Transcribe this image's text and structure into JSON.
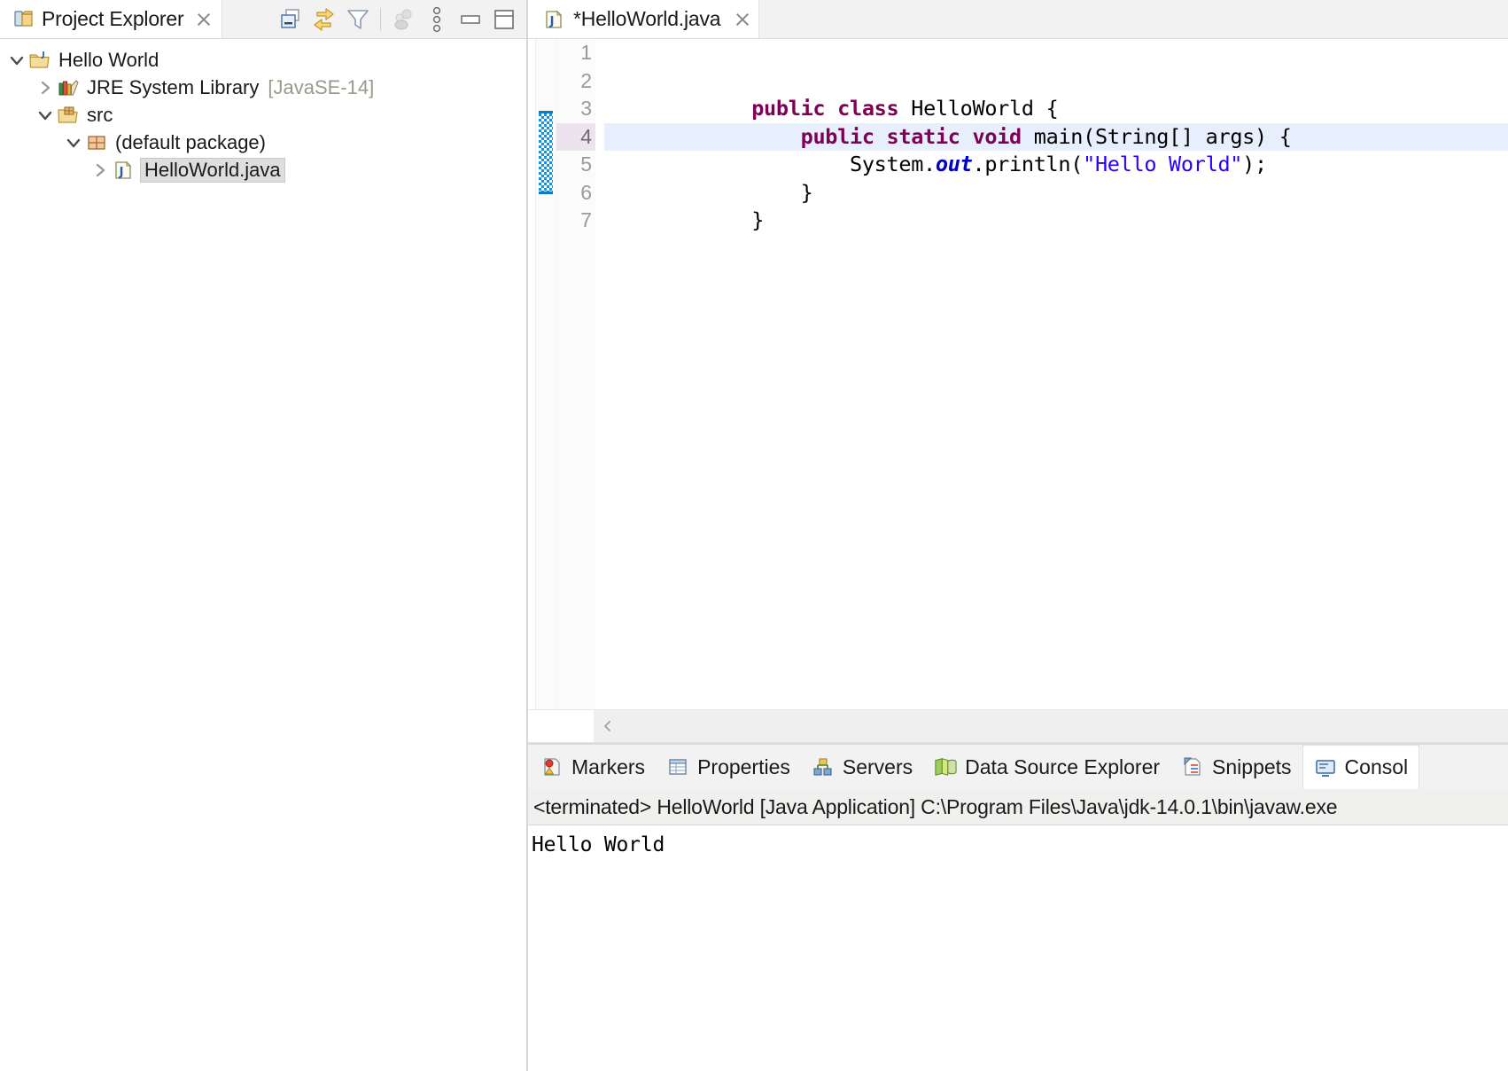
{
  "explorer": {
    "title": "Project Explorer",
    "icons": {
      "view": "project-explorer-icon",
      "close": "close-icon"
    },
    "toolbar": [
      {
        "name": "collapse-all-icon",
        "label": "Collapse All",
        "enabled": true
      },
      {
        "name": "link-with-editor-icon",
        "label": "Link with Editor",
        "enabled": true
      },
      {
        "name": "filter-icon",
        "label": "View Menu Filters",
        "enabled": true
      },
      {
        "name": "focus-on-active-task-icon",
        "label": "Focus on Active Task",
        "enabled": false
      },
      {
        "name": "view-menu-icon",
        "label": "View Menu",
        "enabled": true
      },
      {
        "name": "minimize-icon",
        "label": "Minimize",
        "enabled": true
      },
      {
        "name": "maximize-icon",
        "label": "Maximize",
        "enabled": true
      }
    ],
    "tree": [
      {
        "label": "Hello World",
        "sub": "",
        "depth": 0,
        "expanded": true,
        "icon": "java-project-icon",
        "selected": false
      },
      {
        "label": "JRE System Library",
        "sub": "[JavaSE-14]",
        "depth": 1,
        "expanded": false,
        "icon": "jre-library-icon",
        "selected": false
      },
      {
        "label": "src",
        "sub": "",
        "depth": 1,
        "expanded": true,
        "icon": "source-folder-icon",
        "selected": false
      },
      {
        "label": "(default package)",
        "sub": "",
        "depth": 2,
        "expanded": true,
        "icon": "package-icon",
        "selected": false
      },
      {
        "label": "HelloWorld.java",
        "sub": "",
        "depth": 3,
        "expanded": false,
        "icon": "java-file-icon",
        "selected": true
      }
    ]
  },
  "editor": {
    "tab": {
      "title": "*HelloWorld.java",
      "icon": "java-file-icon",
      "close_icon": "close-icon",
      "dirty": true
    },
    "lines": [
      {
        "number": "1",
        "current": false,
        "changed": false,
        "fold": false,
        "tokens": []
      },
      {
        "number": "2",
        "current": false,
        "changed": false,
        "fold": false,
        "tokens": [
          {
            "t": "public",
            "c": "kw"
          },
          {
            "t": " ",
            "c": "plain"
          },
          {
            "t": "class",
            "c": "kw"
          },
          {
            "t": " HelloWorld {",
            "c": "plain"
          }
        ]
      },
      {
        "number": "3",
        "current": false,
        "changed": true,
        "fold": true,
        "tokens": [
          {
            "t": "    ",
            "c": "plain"
          },
          {
            "t": "public",
            "c": "kw"
          },
          {
            "t": " ",
            "c": "plain"
          },
          {
            "t": "static",
            "c": "kw"
          },
          {
            "t": " ",
            "c": "plain"
          },
          {
            "t": "void",
            "c": "kw"
          },
          {
            "t": " main(String[] args) {",
            "c": "plain"
          }
        ]
      },
      {
        "number": "4",
        "current": true,
        "changed": true,
        "fold": false,
        "tokens": [
          {
            "t": "        System.",
            "c": "plain"
          },
          {
            "t": "out",
            "c": "fld"
          },
          {
            "t": ".println(",
            "c": "plain"
          },
          {
            "t": "\"Hello World\"",
            "c": "str"
          },
          {
            "t": ");",
            "c": "plain"
          }
        ]
      },
      {
        "number": "5",
        "current": false,
        "changed": true,
        "fold": false,
        "tokens": [
          {
            "t": "    }",
            "c": "plain"
          }
        ]
      },
      {
        "number": "6",
        "current": false,
        "changed": false,
        "fold": false,
        "tokens": [
          {
            "t": "}",
            "c": "plain"
          }
        ]
      },
      {
        "number": "7",
        "current": false,
        "changed": false,
        "fold": false,
        "tokens": []
      }
    ],
    "scroll": {
      "left_arrow_icon": "chevron-left-icon"
    }
  },
  "bottom_panel": {
    "tabs": [
      {
        "label": "Markers",
        "icon": "markers-icon",
        "active": false
      },
      {
        "label": "Properties",
        "icon": "properties-icon",
        "active": false
      },
      {
        "label": "Servers",
        "icon": "servers-icon",
        "active": false
      },
      {
        "label": "Data Source Explorer",
        "icon": "data-source-explorer-icon",
        "active": false
      },
      {
        "label": "Snippets",
        "icon": "snippets-icon",
        "active": false
      },
      {
        "label": "Consol",
        "icon": "console-icon",
        "active": true
      }
    ],
    "console": {
      "header": "<terminated> HelloWorld [Java Application] C:\\Program Files\\Java\\jdk-14.0.1\\bin\\javaw.exe",
      "output": "Hello World"
    }
  },
  "colors": {
    "keyword": "#7f0055",
    "string": "#2a00ff",
    "field": "#0000c0",
    "current_line": "#e8effc",
    "change_bar": "#1e8fd0",
    "selection": "#dedede"
  }
}
